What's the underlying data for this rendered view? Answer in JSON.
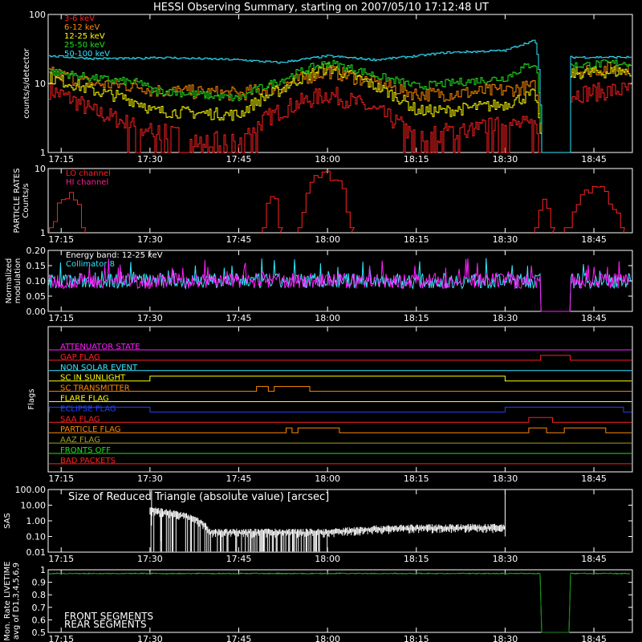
{
  "title": "HESSI Observing Summary, starting on 2007/05/10 17:12:48 UT",
  "time_ticks": [
    "17:15",
    "17:30",
    "17:45",
    "18:00",
    "18:15",
    "18:30",
    "18:45"
  ],
  "chart_data": [
    {
      "type": "line",
      "panel": "count-rates",
      "ylabel": "counts/s/detector",
      "y_scale": "log",
      "ylim": [
        1,
        100
      ],
      "y_ticks": [
        "1",
        "10",
        "100"
      ],
      "legend_placement": "top-left",
      "x": [
        "17:13",
        "17:20",
        "17:29",
        "17:30",
        "17:45",
        "17:52",
        "18:00",
        "18:08",
        "18:15",
        "18:20",
        "18:30",
        "18:35",
        "18:36",
        "18:41",
        "18:50"
      ],
      "series": [
        {
          "name": "3-6 keV",
          "color": "#ff2020",
          "values": [
            8,
            4,
            2,
            2,
            1.3,
            4,
            7,
            4,
            1.5,
            2,
            2.5,
            2.5,
            1,
            7,
            8
          ]
        },
        {
          "name": "6-12 keV",
          "color": "#ff8a00",
          "values": [
            14,
            10,
            9,
            8,
            7,
            9,
            15,
            10,
            7,
            7,
            8,
            9,
            1,
            15,
            17
          ]
        },
        {
          "name": "12-25 keV",
          "color": "#ffff00",
          "values": [
            12,
            8,
            5,
            4,
            3.5,
            8,
            17,
            9,
            4,
            4,
            5,
            7,
            1,
            14,
            15
          ]
        },
        {
          "name": "25-50 keV",
          "color": "#20e020",
          "values": [
            15,
            12,
            10,
            8,
            6,
            11,
            20,
            13,
            9,
            10,
            12,
            20,
            1,
            18,
            20
          ]
        },
        {
          "name": "50-100 keV",
          "color": "#30e8ff",
          "values": [
            25,
            23,
            23,
            24,
            22,
            20,
            25,
            22,
            25,
            28,
            30,
            42,
            1,
            24,
            24
          ]
        }
      ]
    },
    {
      "type": "line",
      "panel": "particle-rates",
      "ylabel": "PARTICLE RATES\nCounts/s",
      "y_scale": "log",
      "ylim": [
        1,
        10
      ],
      "y_ticks": [
        "1",
        "10"
      ],
      "series": [
        {
          "name": "LO channel",
          "color": "#ff2020",
          "values": []
        },
        {
          "name": "HI channel",
          "color": "#ff2090",
          "values": []
        }
      ],
      "events": [
        {
          "start": "17:13",
          "end": "17:19",
          "peak": 4
        },
        {
          "start": "17:49",
          "end": "17:52",
          "peak": 4
        },
        {
          "start": "17:55",
          "end": "18:04",
          "peak": 9
        },
        {
          "start": "18:35",
          "end": "18:38",
          "peak": 3
        },
        {
          "start": "18:40",
          "end": "18:50",
          "peak": 5
        }
      ]
    },
    {
      "type": "line",
      "panel": "modulation",
      "ylabel": "Normalized\nmodulation",
      "ylim": [
        0.0,
        0.2
      ],
      "y_ticks": [
        "0.00",
        "0.05",
        "0.10",
        "0.15",
        "0.20"
      ],
      "annotations": [
        "Energy band: 12-25 keV",
        "Collimator 8"
      ],
      "series": [
        {
          "name": "Collimator 8 (cyan)",
          "color": "#30e8ff",
          "mean": 0.1
        },
        {
          "name": "magenta",
          "color": "#ff20ff",
          "mean": 0.1
        }
      ],
      "gaps": [
        [
          "18:36",
          "18:41"
        ]
      ]
    },
    {
      "type": "line",
      "panel": "flags",
      "ylabel": "Flags",
      "flags": [
        {
          "name": "ATTENUATOR STATE",
          "color": "#ff20ff",
          "on": []
        },
        {
          "name": "GAP FLAG",
          "color": "#ff2020",
          "on": [
            [
              "18:36",
              "18:41"
            ]
          ]
        },
        {
          "name": "NON SOLAR EVENT",
          "color": "#30e8ff",
          "on": []
        },
        {
          "name": "SC IN SUNLIGHT",
          "color": "#ffff00",
          "on": [
            [
              "17:30",
              "18:30"
            ]
          ]
        },
        {
          "name": "SC TRANSMITTER",
          "color": "#ff8a00",
          "on": [
            [
              "17:48",
              "17:50"
            ],
            [
              "17:51",
              "17:57"
            ]
          ]
        },
        {
          "name": "FLARE FLAG",
          "color": "#ffff00",
          "on": []
        },
        {
          "name": "ECLIPSE FLAG",
          "color": "#2040ff",
          "on": [
            [
              "17:13",
              "17:30"
            ],
            [
              "18:30",
              "18:50"
            ]
          ]
        },
        {
          "name": "SAA FLAG",
          "color": "#ff2020",
          "on": [
            [
              "18:34",
              "18:38"
            ]
          ]
        },
        {
          "name": "PARTICLE FLAG",
          "color": "#ff8a00",
          "on": [
            [
              "17:53",
              "17:54"
            ],
            [
              "17:55",
              "18:02"
            ],
            [
              "18:34",
              "18:37"
            ],
            [
              "18:40",
              "18:47"
            ]
          ]
        },
        {
          "name": "AAZ FLAG",
          "color": "#a0a020",
          "on": []
        },
        {
          "name": "FRONTS OFF",
          "color": "#20e020",
          "on": []
        },
        {
          "name": "BAD PACKETS",
          "color": "#ff2020",
          "on": []
        }
      ]
    },
    {
      "type": "line",
      "panel": "sas",
      "ylabel": "SAS",
      "y_scale": "log",
      "ylim": [
        0.01,
        100
      ],
      "y_ticks": [
        "0.01",
        "0.10",
        "1.00",
        "10.00",
        "100.00"
      ],
      "annotation": "Size of Reduced Triangle (absolute value) [arcsec]",
      "series": [
        {
          "name": "SAS triangle",
          "color": "#ffffff",
          "x": [
            "17:30",
            "17:40",
            "18:00",
            "18:10",
            "18:20",
            "18:30"
          ],
          "values": [
            5,
            0.2,
            0.2,
            0.35,
            0.4,
            0.4
          ]
        }
      ]
    },
    {
      "type": "line",
      "panel": "livetime",
      "ylabel": "Mon. Rate LIVETIME\navg of D1,3,4,5,6,9",
      "ylim": [
        0.5,
        1.0
      ],
      "y_ticks": [
        "0.5",
        "0.6",
        "0.7",
        "0.8",
        "0.9",
        "1"
      ],
      "series": [
        {
          "name": "FRONT SEGMENTS",
          "color": "#20e020",
          "value": 0.97
        },
        {
          "name": "REAR SEGMENTS",
          "color": "#208a20",
          "value": 0.97
        }
      ],
      "gaps": [
        [
          "18:36",
          "18:41"
        ]
      ]
    }
  ]
}
